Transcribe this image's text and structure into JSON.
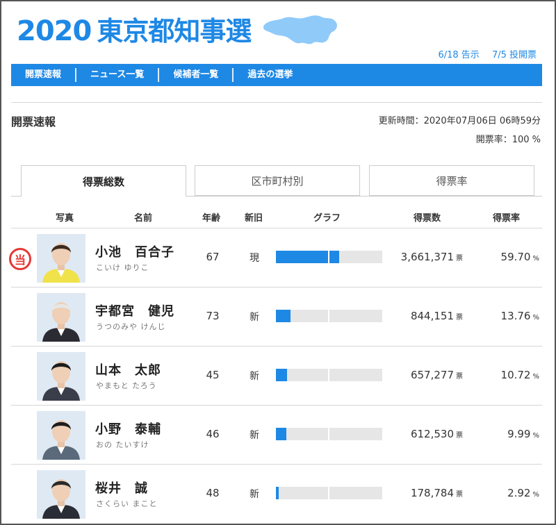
{
  "header": {
    "year": "2020",
    "title": "東京都知事選",
    "date_announce": "6/18 告示",
    "date_vote": "7/5 投開票"
  },
  "nav": {
    "items": [
      "開票速報",
      "ニュース一覧",
      "候補者一覧",
      "過去の選挙"
    ]
  },
  "section": {
    "title": "開票速報",
    "update_time": "更新時間：2020年07月06日 06時59分",
    "open_rate": "開票率：100 %"
  },
  "tabs": [
    "得票総数",
    "区市町村別",
    "得票率"
  ],
  "table": {
    "headers": {
      "photo": "写真",
      "name": "名前",
      "age": "年齢",
      "status": "新旧",
      "graph": "グラフ",
      "votes": "得票数",
      "rate": "得票率"
    },
    "vote_unit": "票",
    "rate_unit": "%",
    "elected_mark": "当",
    "rows": [
      {
        "name": "小池　百合子",
        "kana": "こいけ ゆりこ",
        "age": "67",
        "status": "現",
        "votes": "3,661,371",
        "rate": "59.70",
        "share": 0.597,
        "elected": true,
        "jacket": "#f0e24a",
        "hair": "#3a2a22"
      },
      {
        "name": "宇都宮　健児",
        "kana": "うつのみや けんじ",
        "age": "73",
        "status": "新",
        "votes": "844,151",
        "rate": "13.76",
        "share": 0.1376,
        "elected": false,
        "jacket": "#2b2b33",
        "hair": "#e6e6e6"
      },
      {
        "name": "山本　太郎",
        "kana": "やまもと たろう",
        "age": "45",
        "status": "新",
        "votes": "657,277",
        "rate": "10.72",
        "share": 0.1072,
        "elected": false,
        "jacket": "#3a3e4a",
        "hair": "#1d1d1d"
      },
      {
        "name": "小野　泰輔",
        "kana": "おの たいすけ",
        "age": "46",
        "status": "新",
        "votes": "612,530",
        "rate": "9.99",
        "share": 0.0999,
        "elected": false,
        "jacket": "#5a6a7a",
        "hair": "#1d1d1d"
      },
      {
        "name": "桜井　誠",
        "kana": "さくらい まこと",
        "age": "48",
        "status": "新",
        "votes": "178,784",
        "rate": "2.92",
        "share": 0.0292,
        "elected": false,
        "jacket": "#2a2d36",
        "hair": "#2a2a2a"
      }
    ]
  },
  "colors": {
    "accent": "#1e88e5",
    "elected": "#e53935",
    "bar_track": "#e6e6e6"
  }
}
